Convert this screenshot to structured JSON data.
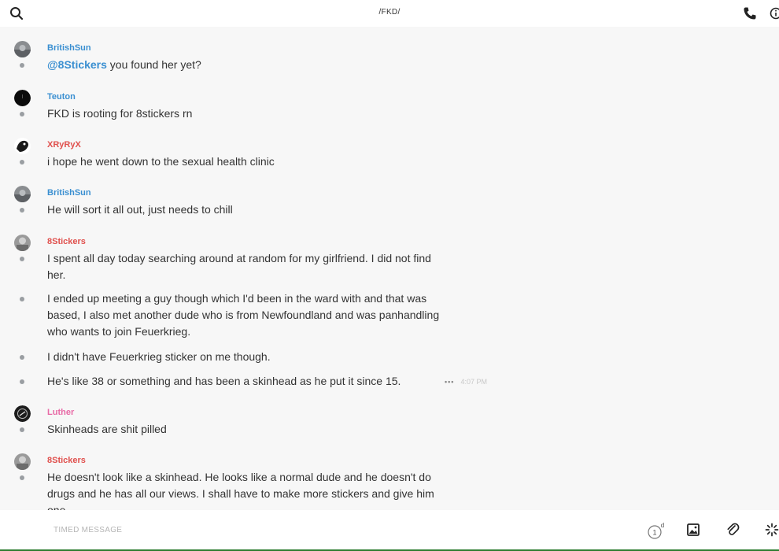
{
  "header": {
    "title": "/FKD/"
  },
  "messages": [
    {
      "user": "BritishSun",
      "user_color": "#3a8fd1",
      "mention": "@8Stickers",
      "text": " you found her yet?"
    },
    {
      "user": "Teuton",
      "user_color": "#3a8fd1",
      "text": "FKD is rooting for 8stickers rn"
    },
    {
      "user": "XRyRyX",
      "user_color": "#e0504d",
      "text": "i hope he went down to the sexual health clinic"
    },
    {
      "user": "BritishSun",
      "user_color": "#3a8fd1",
      "text": "He will sort it all out, just needs to chill"
    },
    {
      "user": "8Stickers",
      "user_color": "#e0504d",
      "text": "I spent all day today searching around at random for my girlfriend. I did not find her."
    },
    {
      "text": "I ended up meeting a guy though which I'd been in the ward with and that was based, I also met another dude who is from Newfoundland and was panhandling who wants to join Feuerkrieg."
    },
    {
      "text": "I didn't have Feuerkrieg sticker on me though."
    },
    {
      "text": "He's like 38 or something and has been a skinhead as he put it since 15.",
      "menu": "•••",
      "time": "4:07 PM"
    },
    {
      "user": "Luther",
      "user_color": "#e86aa6",
      "text": "Skinheads are shit pilled"
    },
    {
      "user": "8Stickers",
      "user_color": "#e0504d",
      "text": "He doesn't look like a skinhead. He looks like a normal dude and he doesn't do drugs and he has all our views. I shall have to make more stickers and give him one."
    }
  ],
  "composer": {
    "placeholder": "TIMED MESSAGE",
    "timer_value": "1",
    "timer_unit": "d"
  },
  "icons": {
    "search": "search-icon",
    "phone": "phone-icon",
    "info": "info-icon",
    "timer": "timer-icon",
    "image": "image-icon",
    "attach": "paperclip-icon",
    "sparkle": "sparkle-icon"
  },
  "colors": {
    "mention": "#3a8fd1",
    "accent_green": "#2e7d32"
  }
}
